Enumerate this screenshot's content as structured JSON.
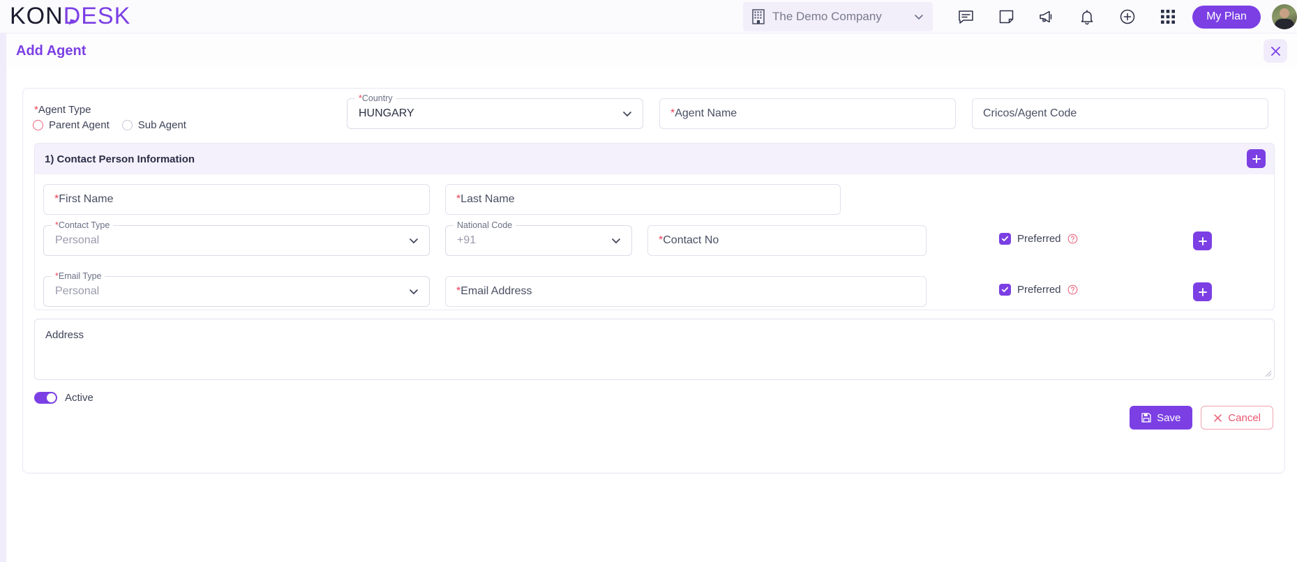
{
  "topbar": {
    "logo_part1": "KON",
    "logo_part2": "DESK",
    "company": {
      "name": "The Demo Company",
      "icon": "building-icon",
      "chevron": "chevron-down-icon"
    },
    "icons": [
      {
        "name": "chat-icon"
      },
      {
        "name": "note-icon"
      },
      {
        "name": "megaphone-icon"
      },
      {
        "name": "bell-icon"
      },
      {
        "name": "plus-circle-icon"
      },
      {
        "name": "apps-grid-icon"
      }
    ],
    "my_plan_label": "My Plan",
    "avatar": "user-avatar"
  },
  "page": {
    "title": "Add Agent",
    "close_icon": "close-icon"
  },
  "form": {
    "agent_type": {
      "label": "Agent Type",
      "required": true,
      "options": [
        {
          "label": "Parent Agent",
          "selected": false,
          "invalid": true
        },
        {
          "label": "Sub Agent",
          "selected": false,
          "invalid": false
        }
      ]
    },
    "country": {
      "label": "Country",
      "required": true,
      "value": "HUNGARY"
    },
    "agent_name": {
      "placeholder": "Agent Name",
      "required": true,
      "value": ""
    },
    "cricos_code": {
      "placeholder": "Cricos/Agent Code",
      "required": false,
      "value": ""
    },
    "section": {
      "title": "1) Contact Person Information",
      "add_button_icon": "plus-icon",
      "first_name": {
        "placeholder": "First Name",
        "required": true,
        "value": ""
      },
      "last_name": {
        "placeholder": "Last Name",
        "required": true,
        "value": ""
      },
      "contact_type": {
        "label": "Contact Type",
        "required": true,
        "value": "Personal"
      },
      "national_code": {
        "label": "National Code",
        "required": false,
        "value": "+91"
      },
      "contact_no": {
        "placeholder": "Contact No",
        "required": true,
        "value": ""
      },
      "contact_preferred": {
        "label": "Preferred",
        "checked": true,
        "help_icon": "help-circle-icon"
      },
      "contact_add_icon": "plus-icon",
      "email_type": {
        "label": "Email Type",
        "required": true,
        "value": "Personal"
      },
      "email_address": {
        "placeholder": "Email Address",
        "required": true,
        "value": ""
      },
      "email_preferred": {
        "label": "Preferred",
        "checked": true,
        "help_icon": "help-circle-icon"
      },
      "email_add_icon": "plus-icon"
    },
    "address": {
      "placeholder": "Address",
      "value": ""
    },
    "active_toggle": {
      "label": "Active",
      "on": true
    },
    "save_label": "Save",
    "save_icon": "save-disk-icon",
    "cancel_label": "Cancel",
    "cancel_icon": "close-x-icon"
  },
  "colors": {
    "accent": "#7b3fe4",
    "required": "#e8425a",
    "cancel": "#e8566f",
    "section_header_bg": "#f4f1fc"
  }
}
